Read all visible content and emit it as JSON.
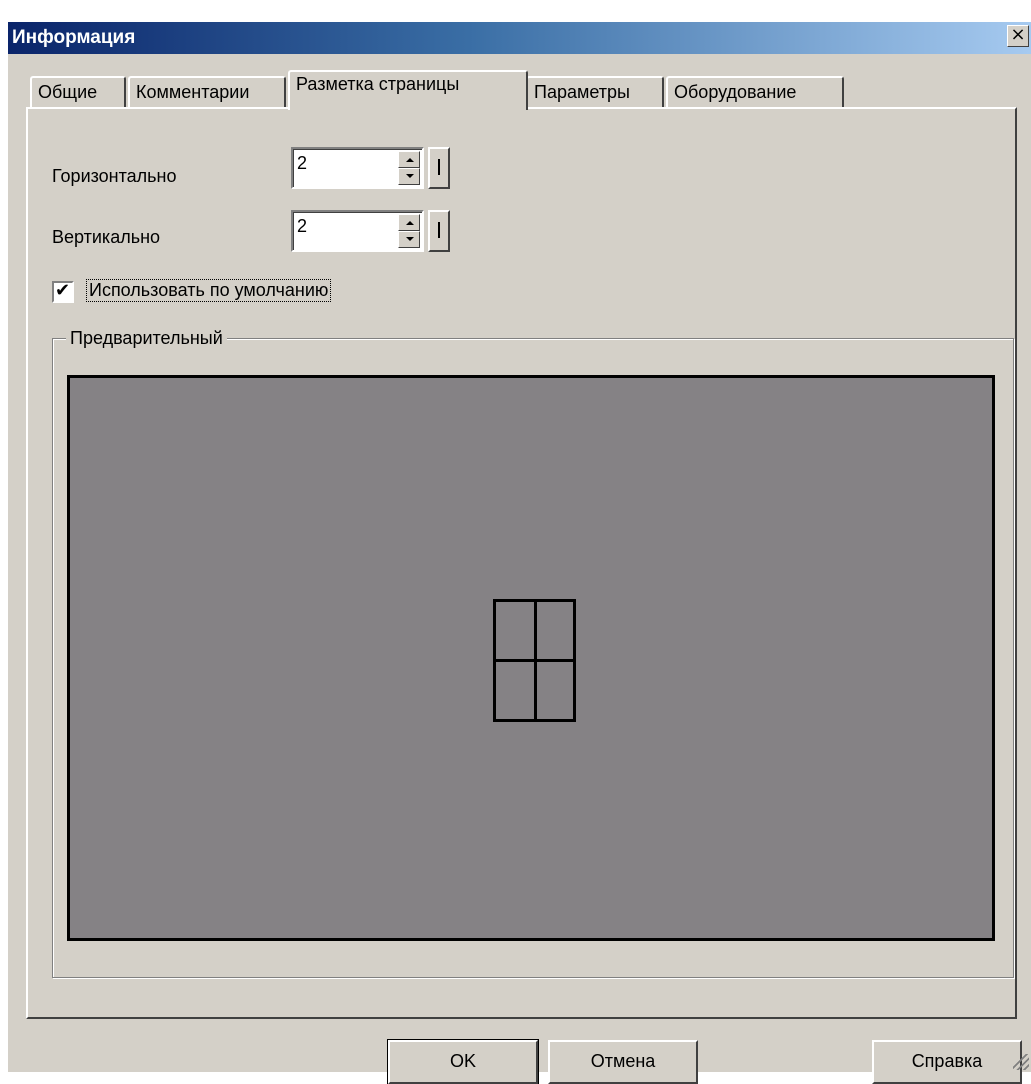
{
  "window": {
    "title": "Информация",
    "close_label": "×"
  },
  "tabs": [
    {
      "label": "Общие",
      "active": false
    },
    {
      "label": "Комментарии",
      "active": false
    },
    {
      "label": "Разметка страницы",
      "active": true
    },
    {
      "label": "Параметры",
      "active": false
    },
    {
      "label": "Оборудование",
      "active": false
    }
  ],
  "layout_tab": {
    "horizontal_label": "Горизонтально",
    "horizontal_value": "2",
    "vertical_label": "Вертикально",
    "vertical_value": "2",
    "default_checkbox_label": "Использовать по умолчанию",
    "default_checked": true,
    "check_glyph": "✔",
    "preview_label": "Предварительный",
    "preview_grid": {
      "columns": 2,
      "rows": 2
    },
    "preview_bg": "#858285"
  },
  "buttons": {
    "ok": "OK",
    "cancel": "Отмена",
    "help": "Справка"
  },
  "icons": {
    "spin_up": "triangle-up-icon",
    "spin_down": "triangle-down-icon",
    "close": "close-icon"
  }
}
